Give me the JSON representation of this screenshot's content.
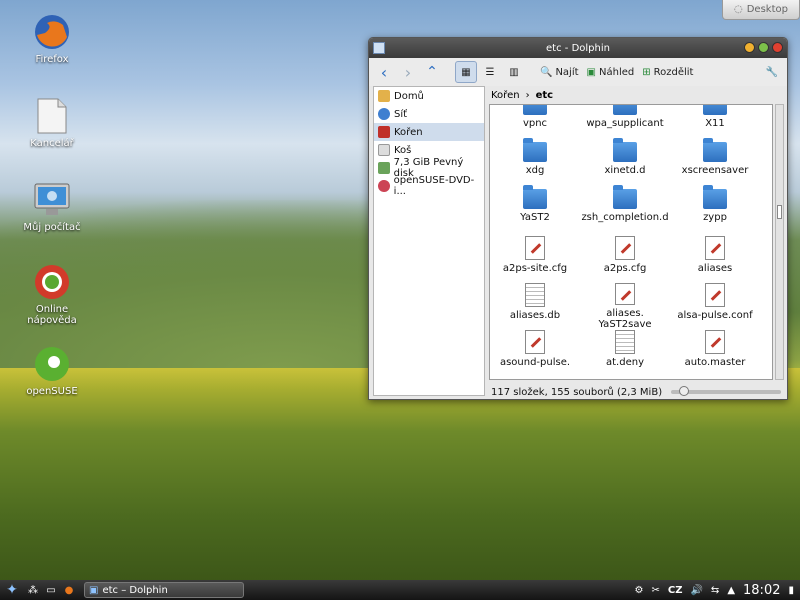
{
  "desktop": {
    "button_label": "Desktop",
    "icons": [
      {
        "label": "Firefox"
      },
      {
        "label": "Kancelář"
      },
      {
        "label": "Můj počítač"
      },
      {
        "label": "Online nápověda"
      },
      {
        "label": "openSUSE"
      }
    ]
  },
  "window": {
    "title": "etc - Dolphin",
    "toolbar": {
      "find": "Najít",
      "preview": "Náhled",
      "split": "Rozdělit"
    },
    "sidebar": [
      {
        "label": "Domů"
      },
      {
        "label": "Síť"
      },
      {
        "label": "Kořen"
      },
      {
        "label": "Koš"
      },
      {
        "label": "7,3 GiB Pevný disk"
      },
      {
        "label": "openSUSE-DVD-i..."
      }
    ],
    "breadcrumb": {
      "root": "Kořen",
      "current": "etc"
    },
    "files": [
      {
        "name": "vpnc",
        "kind": "folder"
      },
      {
        "name": "wpa_supplicant",
        "kind": "folder"
      },
      {
        "name": "X11",
        "kind": "folder"
      },
      {
        "name": "xdg",
        "kind": "folder"
      },
      {
        "name": "xinetd.d",
        "kind": "folder"
      },
      {
        "name": "xscreensaver",
        "kind": "folder"
      },
      {
        "name": "YaST2",
        "kind": "folder"
      },
      {
        "name": "zsh_completion.d",
        "kind": "folder"
      },
      {
        "name": "zypp",
        "kind": "folder"
      },
      {
        "name": "a2ps-site.cfg",
        "kind": "edit"
      },
      {
        "name": "a2ps.cfg",
        "kind": "edit"
      },
      {
        "name": "aliases",
        "kind": "edit"
      },
      {
        "name": "aliases.db",
        "kind": "bin"
      },
      {
        "name": "aliases. YaST2save",
        "kind": "edit"
      },
      {
        "name": "alsa-pulse.conf",
        "kind": "edit"
      },
      {
        "name": "asound-pulse.",
        "kind": "edit"
      },
      {
        "name": "at.deny",
        "kind": "bin"
      },
      {
        "name": "auto.master",
        "kind": "edit"
      }
    ],
    "status": "117 složek, 155 souborů (2,3 MiB)"
  },
  "taskbar": {
    "task": "etc – Dolphin",
    "keyboard": "CZ",
    "clock": "18:02"
  },
  "colors": {
    "selection": "#cfdcec",
    "titlebar": "#3a3a3a"
  }
}
